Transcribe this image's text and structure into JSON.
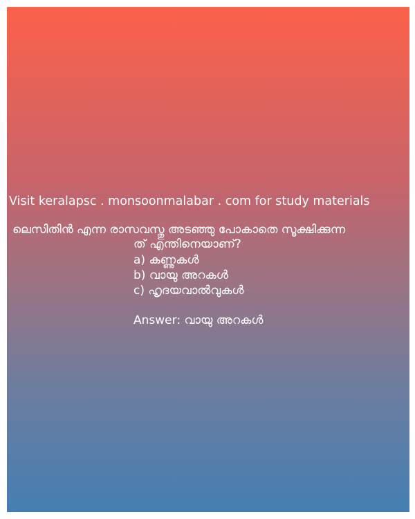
{
  "site_line": "Visit keralapsc . monsoonmalabar . com for study materials",
  "question": {
    "line1": "ലെസിതിൻ  എന്ന രാസവസ്തു അടഞ്ഞു പോകാതെ സൂക്ഷിക്കുന്ന",
    "line2": "ത് എന്തിനെയാണ്?"
  },
  "options": [
    {
      "label": "a) കണ്ണുകൾ"
    },
    {
      "label": "b) വായു  അറകൾ"
    },
    {
      "label": "c) ഹൃദയവാൽവുകൾ"
    }
  ],
  "answer": "Answer: വായു  അറകൾ",
  "colors": {
    "gradient_top": "#fc614a",
    "gradient_bottom": "#457eb3",
    "text": "#ffffff"
  }
}
